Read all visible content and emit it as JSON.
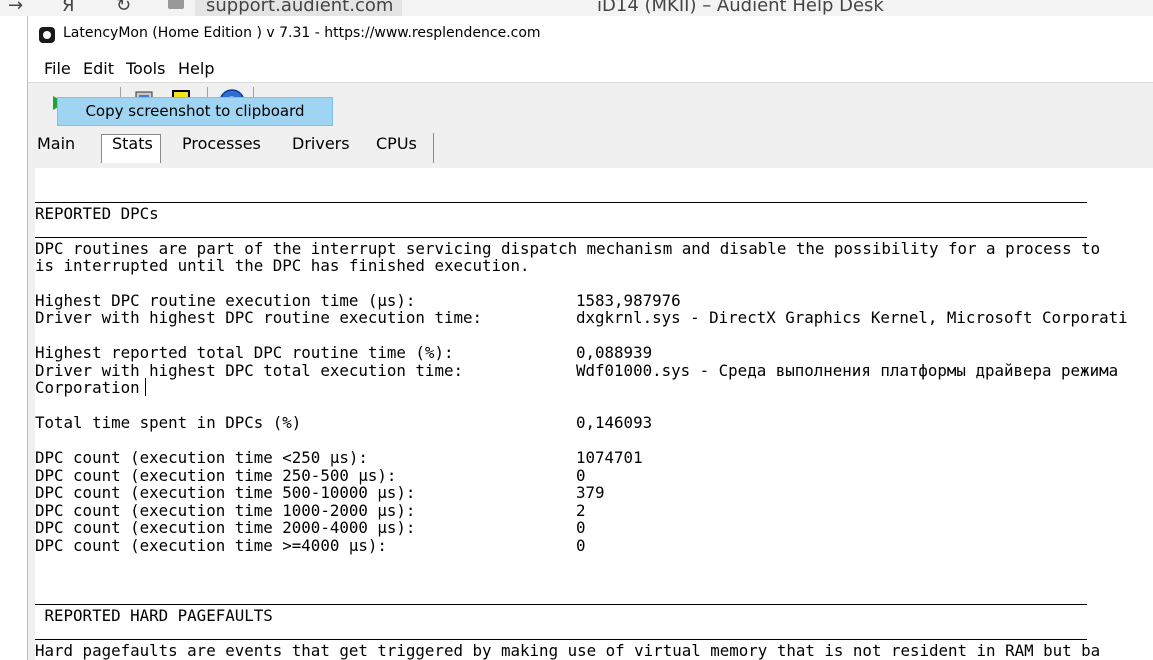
{
  "browser": {
    "back_glyph": "→",
    "yandex_glyph": "Я",
    "reload_glyph": "↻",
    "url": "support.audient.com",
    "tab_title": "iD14 (MKII) – Audient Help Desk"
  },
  "window": {
    "title": "LatencyMon  (Home Edition )  v 7.31 - https://www.resplendence.com"
  },
  "menu": [
    "File",
    "Edit",
    "Tools",
    "Help"
  ],
  "toolbar": {
    "tooltip": "Copy screenshot to clipboard",
    "icons": [
      "start-icon",
      "stop-icon",
      "driver-icon",
      "copy-screenshot-icon",
      "help-icon"
    ]
  },
  "tabs": [
    "Main",
    "Stats",
    "Processes",
    "Drivers",
    "CPUs"
  ],
  "report": {
    "dpc_header": "REPORTED DPCs",
    "dpc_desc_1": "DPC routines are part of the interrupt servicing dispatch mechanism and disable the possibility for a process to",
    "dpc_desc_2": "is interrupted until the DPC has finished execution.",
    "rows": [
      {
        "label": "Highest DPC routine execution time (µs):",
        "value": "1583,987976"
      },
      {
        "label": "Driver with highest DPC routine execution time:",
        "value": "dxgkrnl.sys - DirectX Graphics Kernel, Microsoft Corporati"
      },
      {
        "label": "Highest reported total DPC routine time (%):",
        "value": "0,088939"
      },
      {
        "label": "Driver with highest DPC total execution time:",
        "value": "Wdf01000.sys - Среда выполнения платформы драйвера режима"
      },
      {
        "label": "Corporation",
        "value": ""
      },
      {
        "label": "Total time spent in DPCs (%)",
        "value": "0,146093"
      },
      {
        "label": "DPC count (execution time <250 µs):",
        "value": "1074701"
      },
      {
        "label": "DPC count (execution time 250-500 µs):",
        "value": "0"
      },
      {
        "label": "DPC count (execution time 500-10000 µs):",
        "value": "379"
      },
      {
        "label": "DPC count (execution time 1000-2000 µs):",
        "value": "2"
      },
      {
        "label": "DPC count (execution time 2000-4000 µs):",
        "value": "0"
      },
      {
        "label": "DPC count (execution time >=4000 µs):",
        "value": "0"
      }
    ],
    "pf_header": " REPORTED HARD PAGEFAULTS",
    "pf_desc_1": "Hard pagefaults are events that get triggered by making use of virtual memory that is not resident in RAM but ba"
  }
}
